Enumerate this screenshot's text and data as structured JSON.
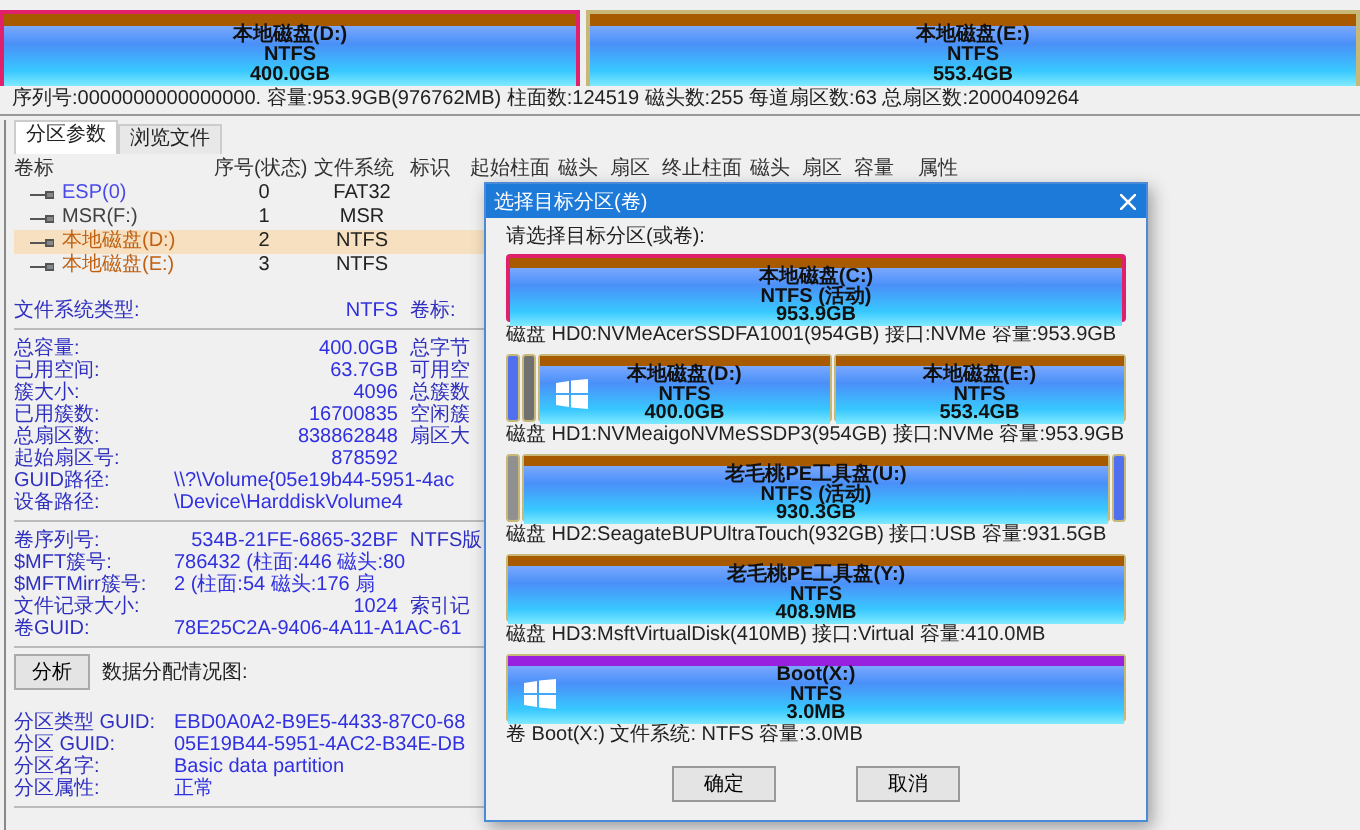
{
  "disk_map": {
    "partitions": [
      {
        "label": "本地磁盘(D:)",
        "fs": "NTFS",
        "size": "400.0GB",
        "selected": true
      },
      {
        "label": "本地磁盘(E:)",
        "fs": "NTFS",
        "size": "553.4GB",
        "selected": false
      }
    ]
  },
  "info_line": "序列号:0000000000000000.  容量:953.9GB(976762MB)  柱面数:124519  磁头数:255  每道扇区数:63  总扇区数:2000409264",
  "tabs": [
    {
      "label": "分区参数",
      "selected": true
    },
    {
      "label": "浏览文件",
      "selected": false
    }
  ],
  "table": {
    "columns": [
      "卷标",
      "序号(状态)",
      "文件系统",
      "标识",
      "起始柱面",
      "磁头",
      "扇区",
      "终止柱面",
      "磁头",
      "扇区",
      "容量",
      "属性"
    ],
    "rows": [
      {
        "cells": [
          "ESP(0)",
          "0",
          "FAT32"
        ],
        "color": "#4a4ae8",
        "selected": false
      },
      {
        "cells": [
          "MSR(F:)",
          "1",
          "MSR"
        ],
        "color": "#404040",
        "selected": false
      },
      {
        "cells": [
          "本地磁盘(D:)",
          "2",
          "NTFS"
        ],
        "color": "#c06010",
        "selected": true
      },
      {
        "cells": [
          "本地磁盘(E:)",
          "3",
          "NTFS"
        ],
        "color": "#c06010",
        "selected": false
      }
    ]
  },
  "details": {
    "sections": [
      [
        {
          "label": "文件系统类型:",
          "value": "NTFS",
          "side": "卷标:"
        }
      ],
      [
        {
          "label": "总容量:",
          "value": "400.0GB",
          "side": "总字节"
        },
        {
          "label": "已用空间:",
          "value": "63.7GB",
          "side": "可用空"
        },
        {
          "label": "簇大小:",
          "value": "4096",
          "side": "总簇数"
        },
        {
          "label": "已用簇数:",
          "value": "16700835",
          "side": "空闲簇"
        },
        {
          "label": "总扇区数:",
          "value": "838862848",
          "side": "扇区大"
        },
        {
          "label": "起始扇区号:",
          "value": "878592"
        },
        {
          "label": "GUID路径:",
          "value": "\\\\?\\Volume{05e19b44-5951-4ac"
        },
        {
          "label": "设备路径:",
          "value": "\\Device\\HarddiskVolume4"
        }
      ],
      [
        {
          "label": "卷序列号:",
          "value": "534B-21FE-6865-32BF",
          "side": "NTFS版"
        },
        {
          "label": "$MFT簇号:",
          "value": "786432 (柱面:446 磁头:80"
        },
        {
          "label": "$MFTMirr簇号:",
          "value": "2 (柱面:54 磁头:176 扇"
        },
        {
          "label": "文件记录大小:",
          "value": "1024",
          "side": "索引记"
        },
        {
          "label": "卷GUID:",
          "value": "78E25C2A-9406-4A11-A1AC-61"
        }
      ]
    ],
    "analysis": {
      "button": "分析",
      "label": "数据分配情况图:"
    },
    "partition_info": [
      {
        "label": "分区类型 GUID:",
        "value": "EBD0A0A2-B9E5-4433-87C0-68"
      },
      {
        "label": "分区 GUID:",
        "value": "05E19B44-5951-4AC2-B34E-DB"
      },
      {
        "label": "分区名字:",
        "value": "Basic data partition"
      },
      {
        "label": "分区属性:",
        "value": "正常"
      }
    ]
  },
  "dialog": {
    "title": "选择目标分区(卷)",
    "prompt": "请选择目标分区(或卷):",
    "disks": [
      {
        "color": "#a85a00",
        "caption": "磁盘 HD0:NVMeAcerSSDFA1001(954GB)  接口:NVMe  容量:953.9GB",
        "partitions": [
          {
            "kind": "volume",
            "label": "本地磁盘(C:)",
            "fs": "NTFS (活动)",
            "size": "953.9GB",
            "selected": true,
            "system": false
          }
        ]
      },
      {
        "color": "#a85a00",
        "caption": "磁盘 HD1:NVMeaigoNVMeSSDP3(954GB)  接口:NVMe  容量:953.9GB",
        "partitions": [
          {
            "kind": "sliver",
            "color": "#5070f0"
          },
          {
            "kind": "sliver",
            "color": "#707070"
          },
          {
            "kind": "volume",
            "label": "本地磁盘(D:)",
            "fs": "NTFS",
            "size": "400.0GB",
            "selected": false,
            "system": true
          },
          {
            "kind": "volume",
            "label": "本地磁盘(E:)",
            "fs": "NTFS",
            "size": "553.4GB",
            "selected": false,
            "system": false
          }
        ]
      },
      {
        "color": "#a85a00",
        "caption": "磁盘 HD2:SeagateBUPUltraTouch(932GB)  接口:USB  容量:931.5GB",
        "partitions": [
          {
            "kind": "sliver",
            "color": "#909090"
          },
          {
            "kind": "volume",
            "label": "老毛桃PE工具盘(U:)",
            "fs": "NTFS (活动)",
            "size": "930.3GB",
            "selected": false,
            "system": false
          },
          {
            "kind": "sliver",
            "color": "#5070f0"
          }
        ]
      },
      {
        "color": "#a85a00",
        "caption": "磁盘 HD3:MsftVirtualDisk(410MB)  接口:Virtual  容量:410.0MB",
        "partitions": [
          {
            "kind": "volume",
            "label": "老毛桃PE工具盘(Y:)",
            "fs": "NTFS",
            "size": "408.9MB",
            "selected": false,
            "system": false
          }
        ]
      },
      {
        "color": "#9a20e0",
        "caption": "卷 Boot(X:)  文件系统: NTFS  容量:3.0MB",
        "partitions": [
          {
            "kind": "volume",
            "label": "Boot(X:)",
            "fs": "NTFS",
            "size": "3.0MB",
            "selected": false,
            "system": true
          }
        ]
      }
    ],
    "buttons": [
      "确定",
      "取消"
    ]
  }
}
